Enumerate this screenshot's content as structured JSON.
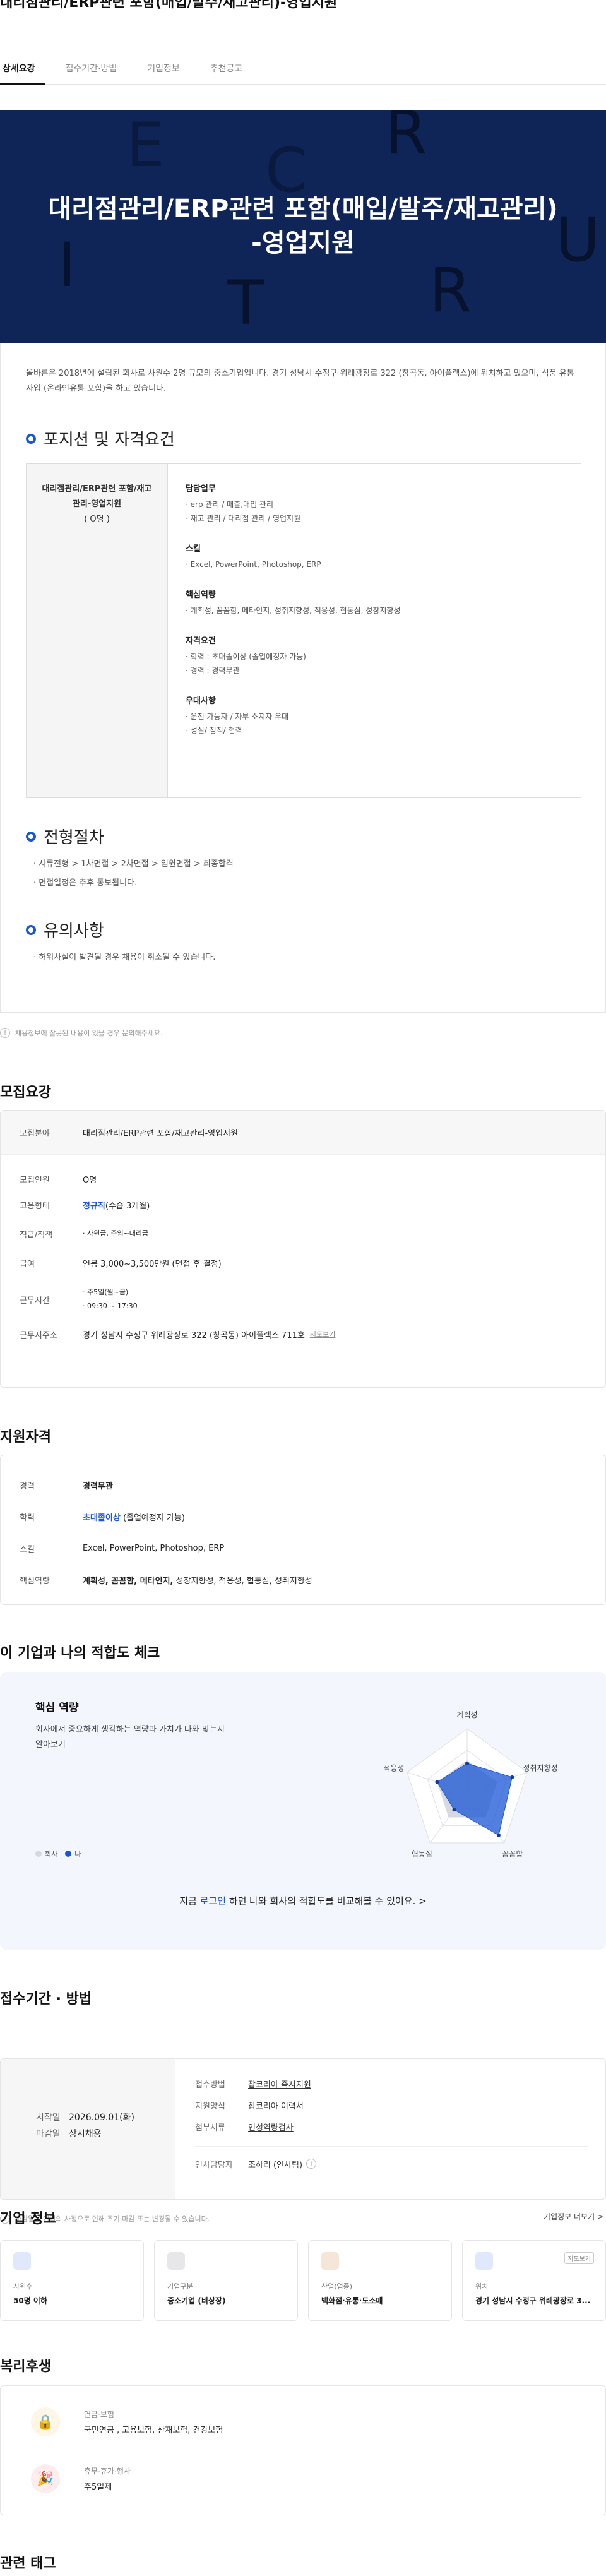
{
  "page_title": "대리점관리/ERP관련 포함(매입/발주/재고관리)-영업지원",
  "tabs": [
    "상세요강",
    "접수기간·방법",
    "기업정보",
    "추천공고"
  ],
  "hero": {
    "line1": "대리점관리/ERP관련 포함(매입/발주/재고관리)",
    "line2": "-영업지원",
    "letters": [
      "E",
      "R",
      "C",
      "U",
      "I",
      "T",
      "R"
    ],
    "bg_color": "#0f2457"
  },
  "intro": "올바른은 2018년에 설립된 회사로 사원수 2명 규모의 중소기업입니다. 경기 성남시 수정구 위례광장로 322 (창곡동, 아이플렉스)에 위치하고 있으며, 식품 유통사업 (온라인유통 포함)을 하고 있습니다.",
  "position": {
    "heading": "포지션 및 자격요건",
    "role_name": "대리점관리/ERP관련 포함/재고관리-영업지원",
    "role_count": "( O명 )",
    "groups": [
      {
        "title": "담당업무",
        "items": [
          "· erp 관리 / 매출,매입 관리",
          "· 재고 관리 / 대리점 관리 / 영업지원"
        ]
      },
      {
        "title": "스킬",
        "items": [
          "· Excel, PowerPoint, Photoshop, ERP"
        ]
      },
      {
        "title": "핵심역량",
        "items": [
          "· 계획성, 꼼꼼함, 메타인지, 성취지향성, 적응성, 협동심, 성장지향성"
        ]
      },
      {
        "title": "자격요건",
        "items": [
          "· 학력 : 초대졸이상 (졸업예정자 가능)",
          "· 경력 : 경력무관"
        ]
      },
      {
        "title": "우대사항",
        "items": [
          "· 운전 가능자 / 자부 소지자 우대",
          "· 성실/ 정직/ 협력"
        ]
      }
    ]
  },
  "process": {
    "heading": "전형절차",
    "lines": [
      "· 서류전형 > 1차면접 > 2차면접 > 임원면접 > 최종합격",
      "· 면접일정은 추후 통보됩니다."
    ]
  },
  "caution": {
    "heading": "유의사항",
    "lines": [
      "· 허위사실이 발견될 경우 채용이 취소될 수 있습니다."
    ]
  },
  "notice_text": "채용정보에 잘못된 내용이 있을 경우 문의해주세요.",
  "recruit": {
    "heading": "모집요강",
    "rows": [
      {
        "k": "모집분야",
        "v": "대리점관리/ERP관련 포함/재고관리-영업지원"
      },
      {
        "k": "모집인원",
        "v": "O명"
      },
      {
        "k": "고용형태",
        "v_strong": "정규직",
        "v": "(수습 3개월)"
      },
      {
        "k": "직급/직책",
        "v": "· 사원급, 주임~대리급"
      },
      {
        "k": "급여",
        "v": "연봉 3,000~3,500만원 (면접 후 결정)"
      },
      {
        "k": "근무시간",
        "v": "· 주5일(월~금)",
        "v2": "· 09:30 ~ 17:30"
      },
      {
        "k": "근무지주소",
        "v": "경기 성남시 수정구 위례광장로 322 (창곡동) 아이플렉스 711호",
        "link": "지도보기"
      }
    ]
  },
  "qualify": {
    "heading": "지원자격",
    "rows": [
      {
        "k": "경력",
        "v_strong": "경력무관",
        "v": ""
      },
      {
        "k": "학력",
        "v_strong": "초대졸이상",
        "v": " (졸업예정자 가능)"
      },
      {
        "k": "스킬",
        "v": "Excel, PowerPoint, Photoshop, ERP"
      },
      {
        "k": "핵심역량",
        "v_bold": "계획성, 꼼꼼함, 메타인지,",
        "v": " 성장지향성, 적응성, 협동심, 성취지향성"
      }
    ]
  },
  "fit": {
    "heading": "이 기업과 나의 적합도 체크",
    "box_title": "핵심 역량",
    "desc": "회사에서 중요하게 생각하는 역량과 가치가 나와 맞는지 알아보기",
    "legend_company": "회사",
    "legend_me": "나",
    "axes": [
      "계획성",
      "성취지향성",
      "꼼꼼함",
      "협동심",
      "적응성"
    ],
    "company_values": [
      0.5,
      0.5,
      0.5,
      0.5,
      0.5
    ],
    "me_values": [
      0.45,
      0.75,
      0.85,
      0.35,
      0.5
    ],
    "footer_pre": "지금 ",
    "footer_link": "로그인",
    "footer_post": " 하면 나와 회사의 적합도를 비교해볼 수 있어요.  >",
    "company_color": "#c9ccd4",
    "me_color": "#1a55d6"
  },
  "apply": {
    "heading": "접수기간 · 방법",
    "start_label": "시작일",
    "start": "2026.09.01(화)",
    "end_label": "마감일",
    "end": "상시채용",
    "rows": [
      {
        "k": "접수방법",
        "v": "잡코리아 즉시지원"
      },
      {
        "k": "지원양식",
        "v": "잡코리아 이력서"
      },
      {
        "k": "첨부서류",
        "v": "인성역량검사"
      },
      {
        "k": "인사담당자",
        "v": "조하리 (인사팀)"
      }
    ],
    "notice": "마감일은 기업의 사정으로 인해 조기 마감 또는 변경될 수 있습니다."
  },
  "company": {
    "heading": "기업 정보",
    "more": "기업정보 더보기 >",
    "cards": [
      {
        "label": "사원수",
        "value": "50명 이하",
        "color": "#dfe9fb"
      },
      {
        "label": "기업구분",
        "value": "중소기업 (비상장)",
        "color": "#e7e7ea"
      },
      {
        "label": "산업(업종)",
        "value": "백화점·유통·도소매",
        "color": "#f6e6d8"
      },
      {
        "label": "위치",
        "value": "경기 성남시 수정구 위례광장로 3...",
        "map": "지도보기",
        "color": "#dfe9fb"
      }
    ]
  },
  "welfare": {
    "heading": "복리후생",
    "items": [
      {
        "label": "연금·보험",
        "value": "국민연금 , 고용보험, 산재보험, 건강보험"
      },
      {
        "label": "휴무·휴가·행사",
        "value": "주5일제"
      }
    ]
  },
  "tags_heading": "관련 태그"
}
